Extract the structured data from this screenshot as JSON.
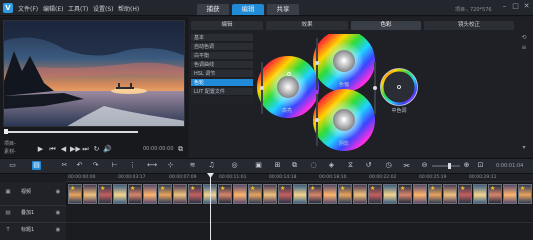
{
  "app": {
    "logo_letter": "V",
    "menu": [
      "文件(F)",
      "编辑(E)",
      "工具(T)",
      "设置(S)",
      "帮助(H)"
    ],
    "modes": [
      "捕获",
      "编辑",
      "共享"
    ],
    "active_mode": "编辑",
    "project_info": "项目-, 720*576",
    "window_controls": [
      "–",
      "□",
      "✕"
    ]
  },
  "preview": {
    "project_label": "项目-",
    "clip_label": "素材-",
    "controls": [
      "▶",
      "⏮",
      "◀",
      "▶▶",
      "⏭",
      "↻",
      "🔊",
      "⧉"
    ],
    "timecode": "00:00:00:00"
  },
  "right_panel": {
    "tabs": [
      "编辑",
      "效果",
      "色彩",
      "镜头校正"
    ],
    "active_tab": "色彩",
    "sub_items": [
      "基本",
      "自动色调",
      "白平衡",
      "色调曲线",
      "HSL 调节",
      "色轮",
      "LUT 配置文件"
    ],
    "active_sub": "色轮",
    "wheels": {
      "highlight": "高亮",
      "midtone": "中色调",
      "shadow": "阴影",
      "color_offset": "色偏"
    }
  },
  "toolbar": {
    "timeline_timecode": "0:00:01:04"
  },
  "timeline": {
    "ruler_labels": [
      "00:00:00:00",
      "00:00:03:17",
      "00:00:07:09",
      "00:00:11:01",
      "00:00:14:18",
      "00:00:18:10",
      "00:00:22:02",
      "00:00:25:19",
      "00:00:29:11"
    ],
    "tracks": [
      {
        "label": "视频",
        "icon": "▣"
      },
      {
        "label": "叠加1",
        "icon": "▤"
      },
      {
        "label": "标题1",
        "icon": "T"
      }
    ],
    "clip_count": 31
  },
  "colors": {
    "accent": "#1f8ad6",
    "panel": "#1e2025",
    "background": "#1b1d22"
  }
}
